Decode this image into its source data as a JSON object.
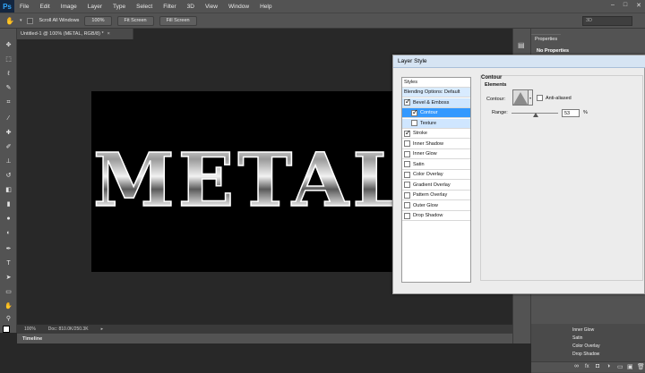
{
  "menubar": {
    "logo": "Ps",
    "items": [
      "File",
      "Edit",
      "Image",
      "Layer",
      "Type",
      "Select",
      "Filter",
      "3D",
      "View",
      "Window",
      "Help"
    ],
    "window_controls": [
      "–",
      "□",
      "✕"
    ]
  },
  "options_bar": {
    "scroll_all_windows_label": "Scroll All Windows",
    "zoom_button": "100%",
    "fit_screen_button": "Fit Screen",
    "fill_screen_button": "Fill Screen",
    "workspace_value": "3D"
  },
  "document": {
    "tab_title": "Untitled-1 @ 100% (METAL, RGB/8) *",
    "canvas_text": "METAL",
    "zoom_status": "100%",
    "doc_status": "Doc: 810.0K/250.3K"
  },
  "timeline": {
    "label": "Timeline"
  },
  "properties_panel": {
    "tab_label": "Properties",
    "empty_label": "No Properties"
  },
  "layers_effects": {
    "items": [
      "Inner Glow",
      "Satin",
      "Color Overlay",
      "Drop Shadow"
    ]
  },
  "layer_style_dialog": {
    "title": "Layer Style",
    "styles_header": "Styles",
    "styles": [
      {
        "label": "Blending Options: Default",
        "checkbox": false,
        "checked": false,
        "state": "highlight"
      },
      {
        "label": "Bevel & Emboss",
        "checkbox": true,
        "checked": true,
        "state": "sub-selected"
      },
      {
        "label": "Contour",
        "checkbox": true,
        "checked": true,
        "state": "selected",
        "indent": true
      },
      {
        "label": "Texture",
        "checkbox": true,
        "checked": false,
        "state": "sub-selected",
        "indent": true
      },
      {
        "label": "Stroke",
        "checkbox": true,
        "checked": true,
        "state": ""
      },
      {
        "label": "Inner Shadow",
        "checkbox": true,
        "checked": false,
        "state": ""
      },
      {
        "label": "Inner Glow",
        "checkbox": true,
        "checked": false,
        "state": ""
      },
      {
        "label": "Satin",
        "checkbox": true,
        "checked": false,
        "state": ""
      },
      {
        "label": "Color Overlay",
        "checkbox": true,
        "checked": false,
        "state": ""
      },
      {
        "label": "Gradient Overlay",
        "checkbox": true,
        "checked": false,
        "state": ""
      },
      {
        "label": "Pattern Overlay",
        "checkbox": true,
        "checked": false,
        "state": ""
      },
      {
        "label": "Outer Glow",
        "checkbox": true,
        "checked": false,
        "state": ""
      },
      {
        "label": "Drop Shadow",
        "checkbox": true,
        "checked": false,
        "state": ""
      }
    ],
    "contour_section": {
      "heading": "Contour",
      "subheading": "Elements",
      "contour_label": "Contour:",
      "anti_aliased_label": "Anti-aliased",
      "range_label": "Range:",
      "range_value": "53",
      "range_unit": "%"
    }
  },
  "colors": {
    "selection_blue": "#3399ff",
    "panel_gray": "#535353",
    "canvas_black": "#000000"
  }
}
